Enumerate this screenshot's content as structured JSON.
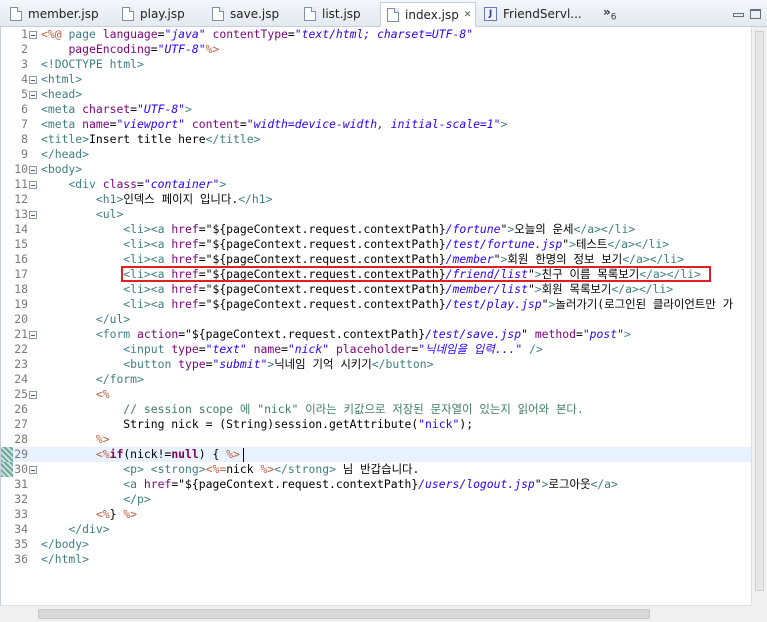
{
  "tabs": [
    {
      "label": "member.jsp",
      "icon": "file-icon",
      "active": false
    },
    {
      "label": "play.jsp",
      "icon": "file-icon",
      "active": false
    },
    {
      "label": "save.jsp",
      "icon": "file-icon",
      "active": false
    },
    {
      "label": "list.jsp",
      "icon": "file-icon",
      "active": false
    },
    {
      "label": "index.jsp",
      "icon": "file-icon",
      "active": true,
      "close": "✕"
    },
    {
      "label": "FriendServl...",
      "icon": "java-class-icon",
      "active": false
    }
  ],
  "overflow": {
    "arrows": "»",
    "count": "6"
  },
  "editor": {
    "lines": [
      {
        "n": "1",
        "fold": true,
        "tokens": [
          [
            "jsp",
            "<%@ "
          ],
          [
            "tag",
            "page "
          ],
          [
            "attr",
            "language"
          ],
          [
            "text",
            "="
          ],
          [
            "val",
            "\"java\""
          ],
          [
            "text",
            " "
          ],
          [
            "attr",
            "contentType"
          ],
          [
            "text",
            "="
          ],
          [
            "val",
            "\"text/html; charset=UTF-8\""
          ]
        ]
      },
      {
        "n": "2",
        "tokens": [
          [
            "text",
            "    "
          ],
          [
            "attr",
            "pageEncoding"
          ],
          [
            "text",
            "="
          ],
          [
            "val",
            "\"UTF-8\""
          ],
          [
            "jsp",
            "%>"
          ]
        ]
      },
      {
        "n": "3",
        "tokens": [
          [
            "tag",
            "<!DOCTYPE "
          ],
          [
            "tag",
            "html"
          ],
          [
            "tag",
            ">"
          ]
        ]
      },
      {
        "n": "4",
        "fold": true,
        "tokens": [
          [
            "tag",
            "<html>"
          ]
        ]
      },
      {
        "n": "5",
        "fold": true,
        "tokens": [
          [
            "tag",
            "<head>"
          ]
        ]
      },
      {
        "n": "6",
        "tokens": [
          [
            "tag",
            "<meta "
          ],
          [
            "attr",
            "charset"
          ],
          [
            "text",
            "="
          ],
          [
            "val",
            "\"UTF-8\""
          ],
          [
            "tag",
            ">"
          ]
        ]
      },
      {
        "n": "7",
        "tokens": [
          [
            "tag",
            "<meta "
          ],
          [
            "attr",
            "name"
          ],
          [
            "text",
            "="
          ],
          [
            "val",
            "\"viewport\""
          ],
          [
            "text",
            " "
          ],
          [
            "attr",
            "content"
          ],
          [
            "text",
            "="
          ],
          [
            "val",
            "\"width=device-width, initial-scale=1\""
          ],
          [
            "tag",
            ">"
          ]
        ]
      },
      {
        "n": "8",
        "tokens": [
          [
            "tag",
            "<title>"
          ],
          [
            "text",
            "Insert title here"
          ],
          [
            "tag",
            "</title>"
          ]
        ]
      },
      {
        "n": "9",
        "tokens": [
          [
            "tag",
            "</head>"
          ]
        ]
      },
      {
        "n": "10",
        "fold": true,
        "tokens": [
          [
            "tag",
            "<body>"
          ]
        ]
      },
      {
        "n": "11",
        "fold": true,
        "tokens": [
          [
            "text",
            "    "
          ],
          [
            "tag",
            "<div "
          ],
          [
            "attr",
            "class"
          ],
          [
            "text",
            "="
          ],
          [
            "val",
            "\"container\""
          ],
          [
            "tag",
            ">"
          ]
        ]
      },
      {
        "n": "12",
        "tokens": [
          [
            "text",
            "        "
          ],
          [
            "tag",
            "<h1>"
          ],
          [
            "text",
            "인덱스 페이지 입니다."
          ],
          [
            "tag",
            "</h1>"
          ]
        ]
      },
      {
        "n": "13",
        "fold": true,
        "tokens": [
          [
            "text",
            "        "
          ],
          [
            "tag",
            "<ul>"
          ]
        ]
      },
      {
        "n": "14",
        "tokens": [
          [
            "text",
            "            "
          ],
          [
            "tag",
            "<li><a "
          ],
          [
            "attr",
            "href"
          ],
          [
            "text",
            "=\"${pageContext.request.contextPath}"
          ],
          [
            "val",
            "/fortune"
          ],
          [
            "text",
            "\""
          ],
          [
            "tag",
            ">"
          ],
          [
            "text",
            "오늘의 운세"
          ],
          [
            "tag",
            "</a></li>"
          ]
        ]
      },
      {
        "n": "15",
        "tokens": [
          [
            "text",
            "            "
          ],
          [
            "tag",
            "<li><a "
          ],
          [
            "attr",
            "href"
          ],
          [
            "text",
            "=\"${pageContext.request.contextPath}"
          ],
          [
            "val",
            "/test/fortune.jsp"
          ],
          [
            "text",
            "\""
          ],
          [
            "tag",
            ">"
          ],
          [
            "text",
            "테스트"
          ],
          [
            "tag",
            "</a></li>"
          ]
        ]
      },
      {
        "n": "16",
        "tokens": [
          [
            "text",
            "            "
          ],
          [
            "tag",
            "<li><a "
          ],
          [
            "attr",
            "href"
          ],
          [
            "text",
            "=\"${pageContext.request.contextPath}"
          ],
          [
            "val",
            "/member"
          ],
          [
            "text",
            "\""
          ],
          [
            "tag",
            ">"
          ],
          [
            "text",
            "회원 한명의 정보 보기"
          ],
          [
            "tag",
            "</a></li>"
          ]
        ]
      },
      {
        "n": "17",
        "tokens": [
          [
            "text",
            "            "
          ],
          [
            "tag",
            "<li><a "
          ],
          [
            "attr",
            "href"
          ],
          [
            "text",
            "=\"${pageContext.request.contextPath}"
          ],
          [
            "val",
            "/friend/list"
          ],
          [
            "text",
            "\""
          ],
          [
            "tag",
            ">"
          ],
          [
            "text",
            "친구 이름 목록보기"
          ],
          [
            "tag",
            "</a></li>"
          ]
        ]
      },
      {
        "n": "18",
        "tokens": [
          [
            "text",
            "            "
          ],
          [
            "tag",
            "<li><a "
          ],
          [
            "attr",
            "href"
          ],
          [
            "text",
            "=\"${pageContext.request.contextPath}"
          ],
          [
            "val",
            "/member/list"
          ],
          [
            "text",
            "\""
          ],
          [
            "tag",
            ">"
          ],
          [
            "text",
            "회원 목록보기"
          ],
          [
            "tag",
            "</a></li>"
          ]
        ]
      },
      {
        "n": "19",
        "tokens": [
          [
            "text",
            "            "
          ],
          [
            "tag",
            "<li><a "
          ],
          [
            "attr",
            "href"
          ],
          [
            "text",
            "=\"${pageContext.request.contextPath}"
          ],
          [
            "val",
            "/test/play.jsp"
          ],
          [
            "text",
            "\""
          ],
          [
            "tag",
            ">"
          ],
          [
            "text",
            "놀러가기(로그인된 클라이언트만 가"
          ]
        ]
      },
      {
        "n": "20",
        "tokens": [
          [
            "text",
            "        "
          ],
          [
            "tag",
            "</ul>"
          ]
        ]
      },
      {
        "n": "21",
        "fold": true,
        "tokens": [
          [
            "text",
            "        "
          ],
          [
            "tag",
            "<form "
          ],
          [
            "attr",
            "action"
          ],
          [
            "text",
            "=\"${pageContext.request.contextPath}"
          ],
          [
            "val",
            "/test/save.jsp"
          ],
          [
            "text",
            "\" "
          ],
          [
            "attr",
            "method"
          ],
          [
            "text",
            "="
          ],
          [
            "val",
            "\"post\""
          ],
          [
            "tag",
            ">"
          ]
        ]
      },
      {
        "n": "22",
        "tokens": [
          [
            "text",
            "            "
          ],
          [
            "tag",
            "<input "
          ],
          [
            "attr",
            "type"
          ],
          [
            "text",
            "="
          ],
          [
            "val",
            "\"text\""
          ],
          [
            "text",
            " "
          ],
          [
            "attr",
            "name"
          ],
          [
            "text",
            "="
          ],
          [
            "val",
            "\"nick\""
          ],
          [
            "text",
            " "
          ],
          [
            "attr",
            "placeholder"
          ],
          [
            "text",
            "="
          ],
          [
            "val",
            "\"닉네임을 입력...\""
          ],
          [
            "text",
            " "
          ],
          [
            "tag",
            "/>"
          ]
        ]
      },
      {
        "n": "23",
        "tokens": [
          [
            "text",
            "            "
          ],
          [
            "tag",
            "<button "
          ],
          [
            "attr",
            "type"
          ],
          [
            "text",
            "="
          ],
          [
            "val",
            "\"submit\""
          ],
          [
            "tag",
            ">"
          ],
          [
            "text",
            "닉네임 기억 시키기"
          ],
          [
            "tag",
            "</button>"
          ]
        ]
      },
      {
        "n": "24",
        "tokens": [
          [
            "text",
            "        "
          ],
          [
            "tag",
            "</form>"
          ]
        ]
      },
      {
        "n": "25",
        "fold": true,
        "tokens": [
          [
            "text",
            "        "
          ],
          [
            "jsp",
            "<%"
          ]
        ]
      },
      {
        "n": "26",
        "tokens": [
          [
            "text",
            "            "
          ],
          [
            "cmt",
            "// session scope 에 \"nick\" 이라는 키값으로 저장된 문자열이 있는지 읽어와 본다."
          ]
        ]
      },
      {
        "n": "27",
        "tokens": [
          [
            "text",
            "            String nick = (String)session.getAttribute("
          ],
          [
            "str",
            "\"nick\""
          ],
          [
            "text",
            ");"
          ]
        ]
      },
      {
        "n": "28",
        "tokens": [
          [
            "text",
            "        "
          ],
          [
            "jsp",
            "%>"
          ]
        ]
      },
      {
        "n": "29",
        "marker": true,
        "current": true,
        "tokens": [
          [
            "text",
            "        "
          ],
          [
            "jsp",
            "<%"
          ],
          [
            "kw",
            "if"
          ],
          [
            "text",
            "(nick!="
          ],
          [
            "kw",
            "null"
          ],
          [
            "text",
            ") { "
          ],
          [
            "jsp",
            "%>"
          ]
        ]
      },
      {
        "n": "30",
        "marker": true,
        "fold": true,
        "tokens": [
          [
            "text",
            "            "
          ],
          [
            "tag",
            "<p>"
          ],
          [
            "text",
            " "
          ],
          [
            "tag",
            "<strong>"
          ],
          [
            "jsp",
            "<%="
          ],
          [
            "text",
            "nick "
          ],
          [
            "jsp",
            "%>"
          ],
          [
            "tag",
            "</strong>"
          ],
          [
            "text",
            " 님 반갑습니다."
          ]
        ]
      },
      {
        "n": "31",
        "tokens": [
          [
            "text",
            "            "
          ],
          [
            "tag",
            "<a "
          ],
          [
            "attr",
            "href"
          ],
          [
            "text",
            "=\"${pageContext.request.contextPath}"
          ],
          [
            "val",
            "/users/logout.jsp"
          ],
          [
            "text",
            "\""
          ],
          [
            "tag",
            ">"
          ],
          [
            "text",
            "로그아웃"
          ],
          [
            "tag",
            "</a>"
          ]
        ]
      },
      {
        "n": "32",
        "tokens": [
          [
            "text",
            "            "
          ],
          [
            "tag",
            "</p>"
          ]
        ]
      },
      {
        "n": "33",
        "tokens": [
          [
            "text",
            "        "
          ],
          [
            "jsp",
            "<%"
          ],
          [
            "text",
            "} "
          ],
          [
            "jsp",
            "%>"
          ]
        ]
      },
      {
        "n": "34",
        "tokens": [
          [
            "text",
            "    "
          ],
          [
            "tag",
            "</div>"
          ]
        ]
      },
      {
        "n": "35",
        "tokens": [
          [
            "tag",
            "</body>"
          ]
        ]
      },
      {
        "n": "36",
        "tokens": [
          [
            "tag",
            "</html>"
          ]
        ]
      }
    ]
  },
  "colors": {
    "tag": "#3f7f7f",
    "attr": "#7f007f",
    "value": "#2a00ff",
    "jsp": "#bf5f3f",
    "highlight_box": "#e02020",
    "current_line": "#e8f2fe"
  }
}
